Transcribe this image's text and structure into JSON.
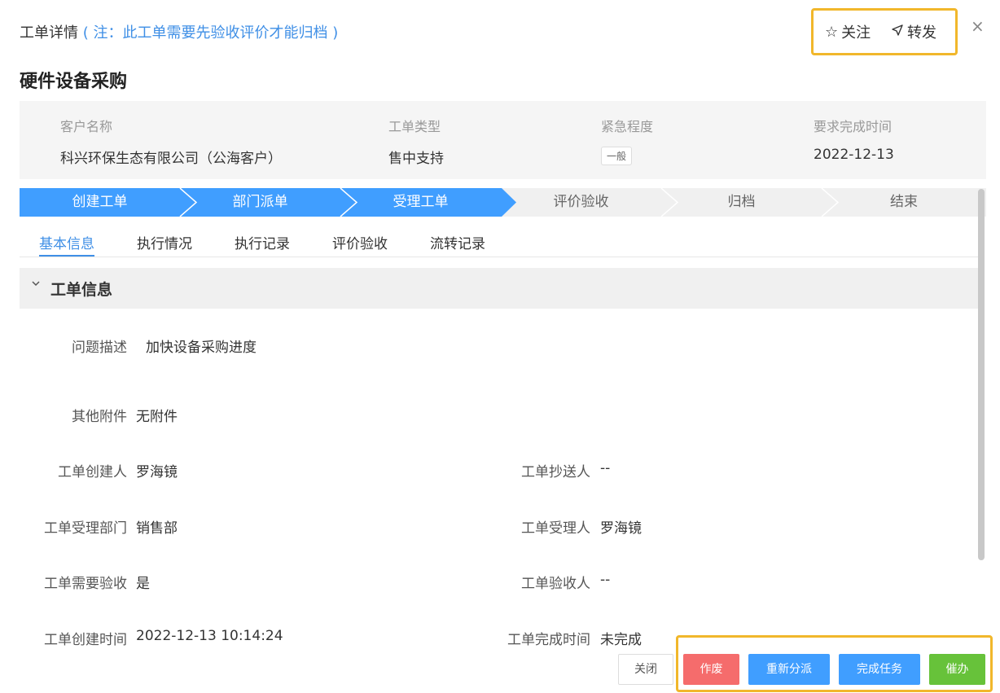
{
  "header": {
    "title": "工单详情",
    "note": "( 注：此工单需要先验收评价才能归档 )",
    "follow_label": "关注",
    "forward_label": "转发",
    "close_glyph": "×"
  },
  "page_title": "硬件设备采购",
  "summary": {
    "customer_label": "客户名称",
    "customer_value": "科兴环保生态有限公司（公海客户）",
    "type_label": "工单类型",
    "type_value": "售中支持",
    "urgency_label": "紧急程度",
    "urgency_value": "一般",
    "due_label": "要求完成时间",
    "due_value": "2022-12-13"
  },
  "steps": [
    {
      "label": "创建工单",
      "state": "done"
    },
    {
      "label": "部门派单",
      "state": "done"
    },
    {
      "label": "受理工单",
      "state": "current"
    },
    {
      "label": "评价验收",
      "state": "pending"
    },
    {
      "label": "归档",
      "state": "pending"
    },
    {
      "label": "结束",
      "state": "pending"
    }
  ],
  "tabs": [
    {
      "label": "基本信息",
      "active": true
    },
    {
      "label": "执行情况",
      "active": false
    },
    {
      "label": "执行记录",
      "active": false
    },
    {
      "label": "评价验收",
      "active": false
    },
    {
      "label": "流转记录",
      "active": false
    }
  ],
  "section": {
    "title": "工单信息"
  },
  "fields": {
    "desc_label": "问题描述",
    "desc_value": "加快设备采购进度",
    "attach_label": "其他附件",
    "attach_value": "无附件",
    "creator_label": "工单创建人",
    "creator_value": "罗海镜",
    "cc_label": "工单抄送人",
    "cc_value": "--",
    "dept_label": "工单受理部门",
    "dept_value": "销售部",
    "assignee_label": "工单受理人",
    "assignee_value": "罗海镜",
    "need_accept_label": "工单需要验收",
    "need_accept_value": "是",
    "acceptor_label": "工单验收人",
    "acceptor_value": "--",
    "created_label": "工单创建时间",
    "created_value": "2022-12-13 10:14:24",
    "finished_label": "工单完成时间",
    "finished_value": "未完成"
  },
  "buttons": {
    "close": "关闭",
    "void": "作废",
    "reassign": "重新分派",
    "complete": "完成任务",
    "urge": "催办"
  },
  "colors": {
    "primary": "#409eff",
    "danger": "#f56c6c",
    "success": "#67c23a",
    "highlight": "#f1b72b",
    "note": "#3f8fe6"
  }
}
